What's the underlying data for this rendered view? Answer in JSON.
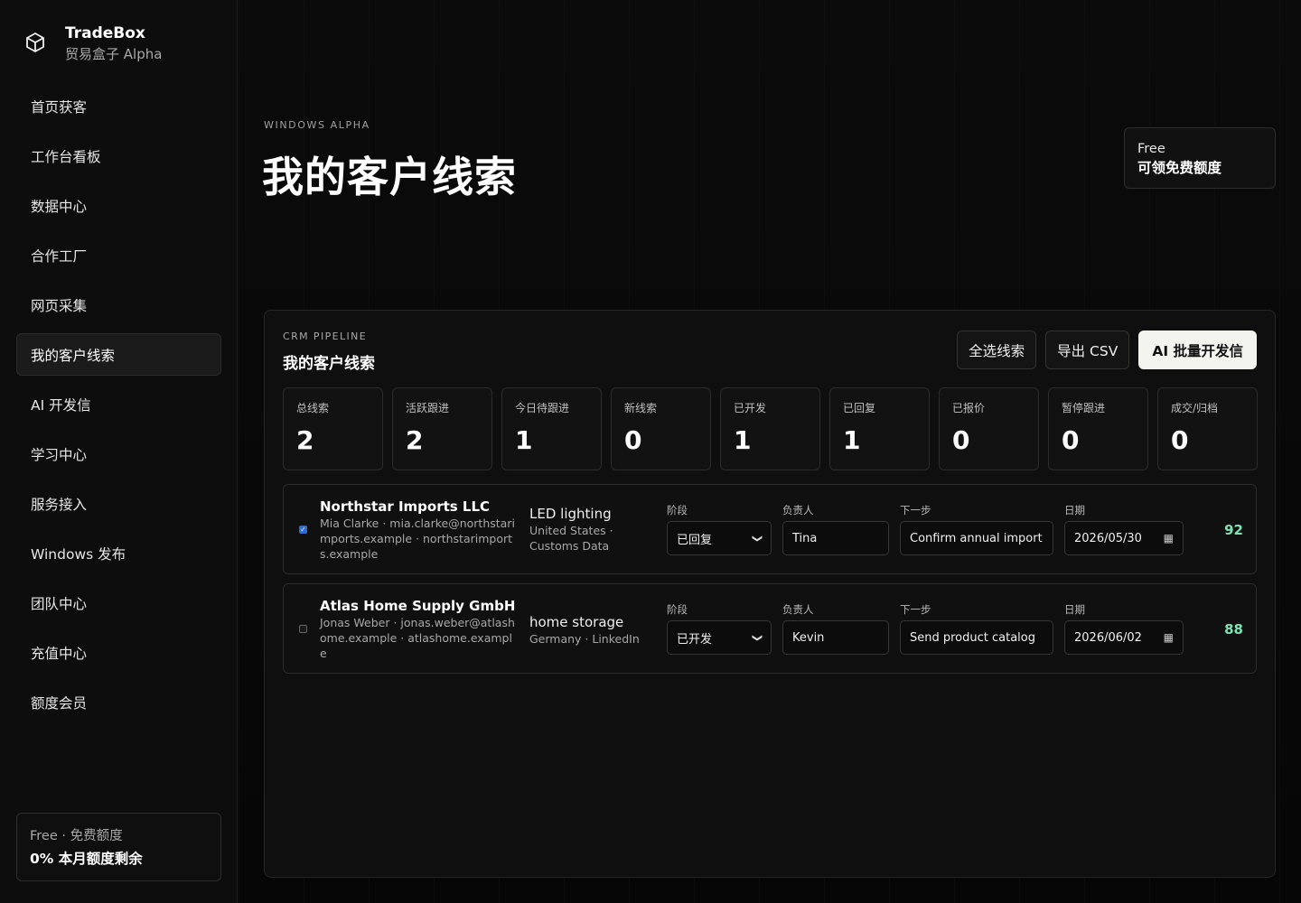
{
  "brand": {
    "name": "TradeBox",
    "subtitle": "贸易盒子 Alpha"
  },
  "sidebar": {
    "items": [
      {
        "label": "首页获客"
      },
      {
        "label": "工作台看板"
      },
      {
        "label": "数据中心"
      },
      {
        "label": "合作工厂"
      },
      {
        "label": "网页采集"
      },
      {
        "label": "我的客户线索",
        "active": true
      },
      {
        "label": "AI 开发信"
      },
      {
        "label": "学习中心"
      },
      {
        "label": "服务接入"
      },
      {
        "label": "Windows 发布"
      },
      {
        "label": "团队中心"
      },
      {
        "label": "充值中心"
      },
      {
        "label": "额度会员"
      }
    ],
    "quota": {
      "plan": "Free · 免费额度",
      "remaining": "0% 本月额度剩余"
    }
  },
  "header": {
    "eyebrow": "WINDOWS ALPHA",
    "title": "我的客户线索",
    "plan_badge": {
      "plan": "Free",
      "cta": "可领免费额度"
    }
  },
  "panel": {
    "eyebrow": "CRM PIPELINE",
    "title": "我的客户线索",
    "actions": {
      "select_all": "全选线索",
      "export_csv": "导出 CSV",
      "ai_batch": "AI 批量开发信"
    },
    "stats": [
      {
        "label": "总线索",
        "value": "2"
      },
      {
        "label": "活跃跟进",
        "value": "2"
      },
      {
        "label": "今日待跟进",
        "value": "1"
      },
      {
        "label": "新线索",
        "value": "0"
      },
      {
        "label": "已开发",
        "value": "1"
      },
      {
        "label": "已回复",
        "value": "1"
      },
      {
        "label": "已报价",
        "value": "0"
      },
      {
        "label": "暂停跟进",
        "value": "0"
      },
      {
        "label": "成交/归档",
        "value": "0"
      }
    ],
    "field_labels": {
      "stage": "阶段",
      "owner": "负责人",
      "next": "下一步",
      "date": "日期"
    },
    "leads": [
      {
        "checked": true,
        "company": "Northstar Imports LLC",
        "contact": "Mia Clarke · mia.clarke@northstarimports.example · northstarimports.example",
        "product": "LED lighting",
        "source": "United States · Customs Data",
        "stage": "已回复",
        "owner": "Tina",
        "next_step": "Confirm annual import vol",
        "date": "2026/05/30",
        "score": "92"
      },
      {
        "checked": false,
        "company": "Atlas Home Supply GmbH",
        "contact": "Jonas Weber · jonas.weber@atlashome.example · atlashome.example",
        "product": "home storage",
        "source": "Germany · LinkedIn",
        "stage": "已开发",
        "owner": "Kevin",
        "next_step": "Send product catalog",
        "date": "2026/06/02",
        "score": "88"
      }
    ]
  },
  "colors": {
    "accent_score": "#7fe3b6",
    "checkbox": "#2b6bd8",
    "primary_button": "#f4f4ef"
  }
}
